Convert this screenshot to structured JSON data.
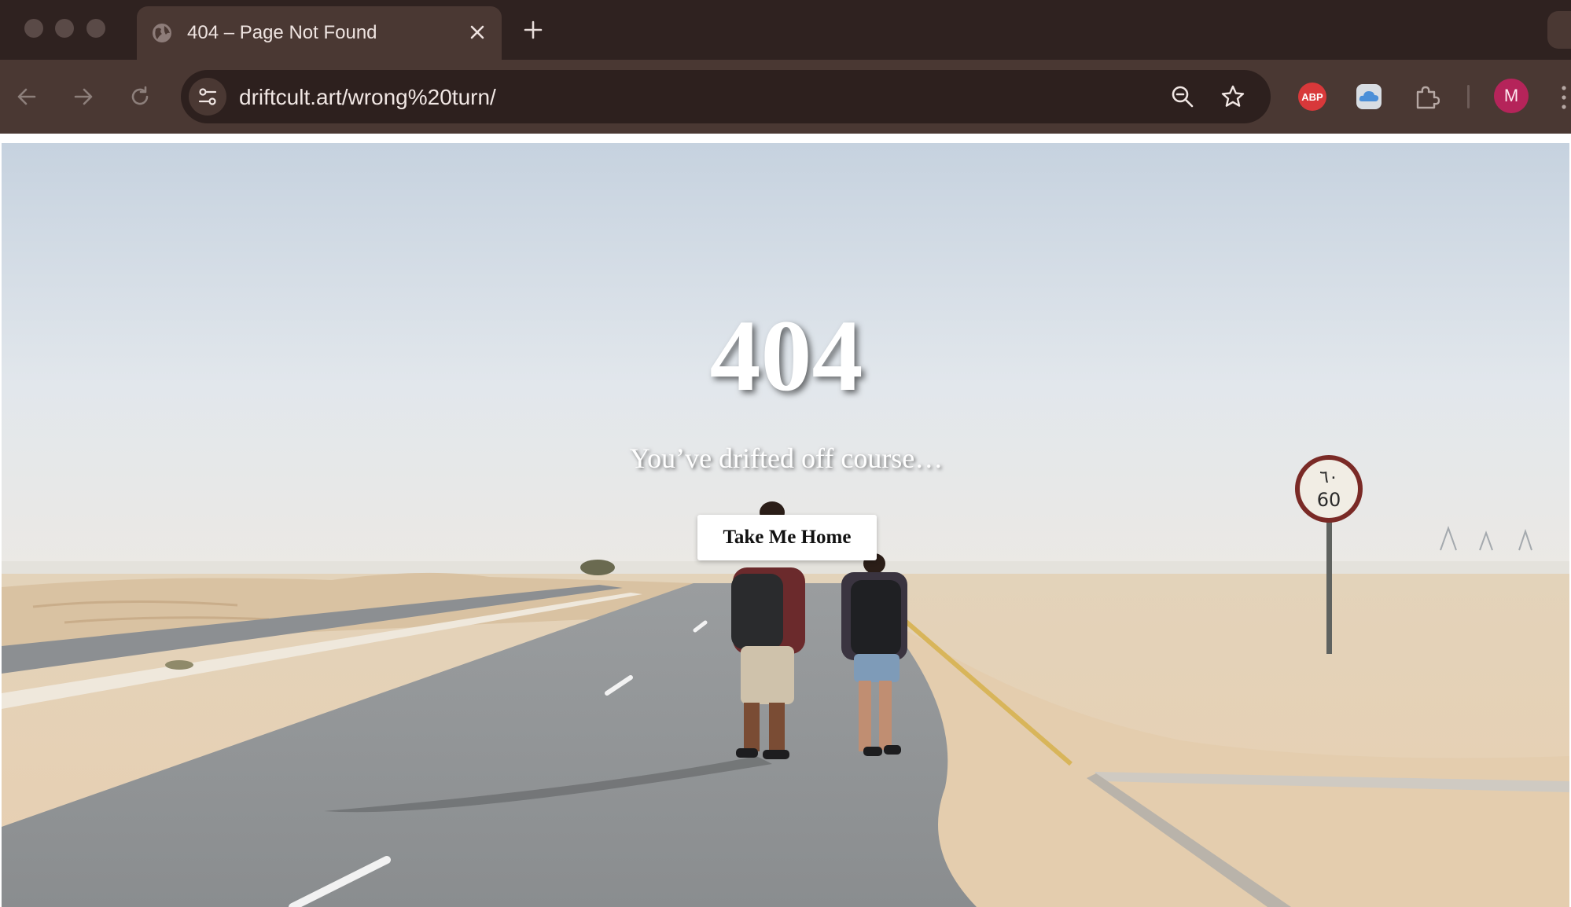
{
  "browser": {
    "tab": {
      "title": "404 – Page Not Found",
      "icon": "globe-icon"
    },
    "url": "driftcult.art/wrong%20turn/",
    "extensions": [
      "adblock-plus-icon",
      "cloud-icon",
      "puzzle-icon"
    ],
    "adblock_label": "ABP",
    "profile_initial": "M",
    "colors": {
      "tabstrip": "#2f2220",
      "toolbar": "#4a3833",
      "omnibox": "#2d201e",
      "avatar": "#b5245a"
    }
  },
  "page": {
    "error_code": "404",
    "message": "You’ve drifted off course…",
    "home_button": "Take Me Home",
    "speed_sign": {
      "top": "٦٠",
      "bottom": "60"
    }
  }
}
